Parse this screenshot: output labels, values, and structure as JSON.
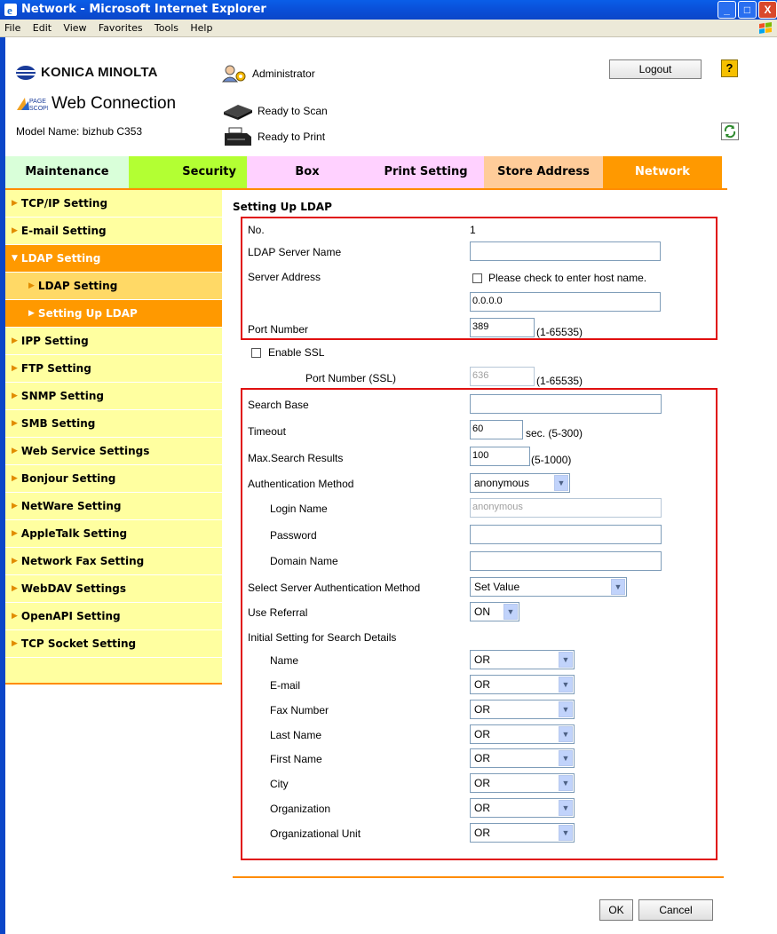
{
  "window": {
    "title": "Network - Microsoft Internet Explorer",
    "menu": [
      "File",
      "Edit",
      "View",
      "Favorites",
      "Tools",
      "Help"
    ]
  },
  "header": {
    "brand": "KONICA MINOLTA",
    "product_small": "PAGE SCOPE",
    "product": "Web Connection",
    "model": "Model Name: bizhub C353",
    "user": "Administrator",
    "scan_status": "Ready to Scan",
    "print_status": "Ready to Print",
    "logout_label": "Logout",
    "help_label": "?"
  },
  "tabs": [
    {
      "label": "Maintenance",
      "color": "#d9ffd9"
    },
    {
      "label": "Security",
      "color": "#b3ff33"
    },
    {
      "label": "Box",
      "color": "#ffd1ff"
    },
    {
      "label": "Print Setting",
      "color": "#ffd1ff"
    },
    {
      "label": "Store Address",
      "color": "#ffcc99"
    },
    {
      "label": "Network",
      "color": "#ff9900",
      "active": true
    }
  ],
  "sidebar": {
    "items": [
      "TCP/IP Setting",
      "E-mail Setting",
      "LDAP Setting",
      "LDAP Setting",
      "Setting Up LDAP",
      "IPP Setting",
      "FTP Setting",
      "SNMP Setting",
      "SMB Setting",
      "Web Service Settings",
      "Bonjour Setting",
      "NetWare Setting",
      "AppleTalk Setting",
      "Network Fax Setting",
      "WebDAV Settings",
      "OpenAPI Setting",
      "TCP Socket Setting"
    ]
  },
  "form": {
    "title": "Setting Up LDAP",
    "no_label": "No.",
    "no_value": "1",
    "server_name_label": "LDAP Server Name",
    "server_name_value": "",
    "server_address_label": "Server Address",
    "host_check_label": "Please check to enter host name.",
    "server_address_value": "0.0.0.0",
    "port_label": "Port Number",
    "port_value": "389",
    "port_range": "(1-65535)",
    "ssl_label": "Enable SSL",
    "ssl_port_label": "Port Number (SSL)",
    "ssl_port_value": "636",
    "ssl_port_range": "(1-65535)",
    "search_base_label": "Search Base",
    "search_base_value": "",
    "timeout_label": "Timeout",
    "timeout_value": "60",
    "timeout_unit": "sec. (5-300)",
    "max_results_label": "Max.Search Results",
    "max_results_value": "100",
    "max_results_range": "(5-1000)",
    "auth_method_label": "Authentication Method",
    "auth_method_value": "anonymous",
    "login_name_label": "Login Name",
    "login_name_value": "anonymous",
    "password_label": "Password",
    "domain_label": "Domain Name",
    "server_auth_label": "Select Server Authentication Method",
    "server_auth_value": "Set Value",
    "referral_label": "Use Referral",
    "referral_value": "ON",
    "search_details_label": "Initial Setting for Search Details",
    "search_fields": [
      {
        "label": "Name",
        "value": "OR"
      },
      {
        "label": "E-mail",
        "value": "OR"
      },
      {
        "label": "Fax Number",
        "value": "OR"
      },
      {
        "label": "Last Name",
        "value": "OR"
      },
      {
        "label": "First Name",
        "value": "OR"
      },
      {
        "label": "City",
        "value": "OR"
      },
      {
        "label": "Organization",
        "value": "OR"
      },
      {
        "label": "Organizational Unit",
        "value": "OR"
      }
    ],
    "ok_label": "OK",
    "cancel_label": "Cancel"
  }
}
